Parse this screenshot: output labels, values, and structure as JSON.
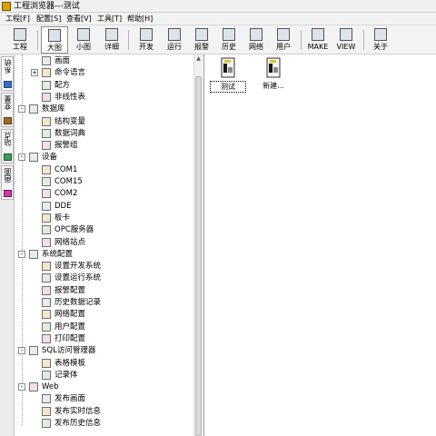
{
  "window": {
    "title": "工程浏览器---测试"
  },
  "menubar": {
    "items": [
      "工程[F]",
      "配置[S]",
      "查看[V]",
      "工具[T]",
      "帮助[H]"
    ]
  },
  "toolbar": {
    "buttons": [
      {
        "label": "工程",
        "icon": "project-icon"
      },
      {
        "label": "大图",
        "icon": "large-icons-icon",
        "active": true
      },
      {
        "label": "小图",
        "icon": "small-icons-icon"
      },
      {
        "label": "详细",
        "icon": "details-icon"
      },
      {
        "label": "开发",
        "icon": "develop-icon"
      },
      {
        "label": "运行",
        "icon": "run-icon"
      },
      {
        "label": "报警",
        "icon": "alarm-icon"
      },
      {
        "label": "历史",
        "icon": "history-icon"
      },
      {
        "label": "网络",
        "icon": "network-icon"
      },
      {
        "label": "用户",
        "icon": "user-icon"
      },
      {
        "label": "MAKE",
        "icon": "make-icon"
      },
      {
        "label": "VIEW",
        "icon": "view-icon"
      },
      {
        "label": "关于",
        "icon": "about-icon"
      }
    ]
  },
  "sidebar": {
    "tabs": [
      {
        "label": "系统",
        "icon": "system-icon"
      },
      {
        "label": "变量",
        "icon": "variable-icon"
      },
      {
        "label": "站点",
        "icon": "station-icon"
      },
      {
        "label": "画面",
        "icon": "screen-icon"
      }
    ]
  },
  "tree": {
    "nodes": [
      {
        "label": "画面",
        "level": 1,
        "icon": "screen-icon"
      },
      {
        "label": "命令语言",
        "level": 1,
        "icon": "command-language-icon",
        "expander": "+"
      },
      {
        "label": "配方",
        "level": 1,
        "icon": "recipe-icon"
      },
      {
        "label": "非线性表",
        "level": 1,
        "icon": "nonlinear-table-icon"
      },
      {
        "label": "数据库",
        "level": 0,
        "icon": "database-icon",
        "expander": "-"
      },
      {
        "label": "结构变量",
        "level": 1,
        "icon": "struct-variable-icon"
      },
      {
        "label": "数据词典",
        "level": 1,
        "icon": "data-dictionary-icon"
      },
      {
        "label": "报警组",
        "level": 1,
        "icon": "alarm-group-icon"
      },
      {
        "label": "设备",
        "level": 0,
        "icon": "device-icon",
        "expander": "-"
      },
      {
        "label": "COM1",
        "level": 1,
        "icon": "com-port-icon"
      },
      {
        "label": "COM15",
        "level": 1,
        "icon": "com-port-icon"
      },
      {
        "label": "COM2",
        "level": 1,
        "icon": "com-port-icon"
      },
      {
        "label": "DDE",
        "level": 1,
        "icon": "dde-icon"
      },
      {
        "label": "板卡",
        "level": 1,
        "icon": "board-card-icon"
      },
      {
        "label": "OPC服务器",
        "level": 1,
        "icon": "opc-server-icon"
      },
      {
        "label": "网络站点",
        "level": 1,
        "icon": "network-station-icon"
      },
      {
        "label": "系统配置",
        "level": 0,
        "icon": "system-config-icon",
        "expander": "-"
      },
      {
        "label": "设置开发系统",
        "level": 1,
        "icon": "dev-system-icon"
      },
      {
        "label": "设置运行系统",
        "level": 1,
        "icon": "run-system-icon"
      },
      {
        "label": "报警配置",
        "level": 1,
        "icon": "alarm-config-icon"
      },
      {
        "label": "历史数据记录",
        "level": 1,
        "icon": "history-record-icon"
      },
      {
        "label": "网络配置",
        "level": 1,
        "icon": "network-config-icon"
      },
      {
        "label": "用户配置",
        "level": 1,
        "icon": "user-config-icon"
      },
      {
        "label": "打印配置",
        "level": 1,
        "icon": "print-config-icon"
      },
      {
        "label": "SQL访问管理器",
        "level": 0,
        "icon": "sql-manager-icon",
        "expander": "-"
      },
      {
        "label": "表格模板",
        "level": 1,
        "icon": "table-template-icon"
      },
      {
        "label": "记录体",
        "level": 1,
        "icon": "record-body-icon"
      },
      {
        "label": "Web",
        "level": 0,
        "icon": "web-folder-icon",
        "expander": "-"
      },
      {
        "label": "发布画面",
        "level": 1,
        "icon": "publish-screen-icon"
      },
      {
        "label": "发布实时信息",
        "level": 1,
        "icon": "publish-realtime-icon"
      },
      {
        "label": "发布历史信息",
        "level": 1,
        "icon": "publish-history-icon"
      }
    ]
  },
  "content": {
    "items": [
      {
        "label": "测试",
        "icon": "screen-file-icon",
        "selected": true
      },
      {
        "label": "新建...",
        "icon": "new-screen-icon",
        "selected": false
      }
    ]
  }
}
